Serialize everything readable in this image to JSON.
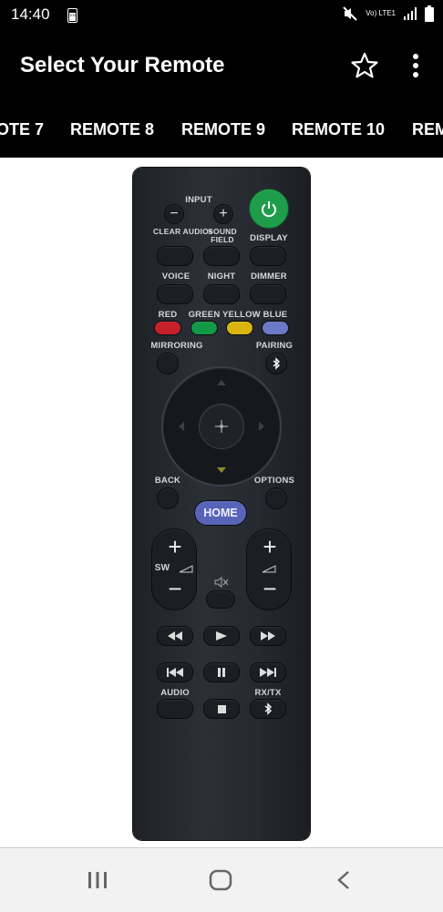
{
  "status_bar": {
    "time": "14:40",
    "battery_level": "100",
    "network": "Vo) LTE1"
  },
  "app_bar": {
    "title": "Select Your Remote"
  },
  "tabs": [
    "OTE 7",
    "REMOTE 8",
    "REMOTE 9",
    "REMOTE 10",
    "REM"
  ],
  "remote": {
    "labels": {
      "input": "INPUT",
      "clear_audio": "CLEAR AUDIO+",
      "sound_field": "SOUND FIELD",
      "display": "DISPLAY",
      "voice": "VOICE",
      "night": "NIGHT",
      "dimmer": "DIMMER",
      "red": "RED",
      "green": "GREEN",
      "yellow": "YELLOW",
      "blue": "BLUE",
      "mirroring": "MIRRORING",
      "pairing": "PAIRING",
      "back": "BACK",
      "options": "OPTIONS",
      "home": "HOME",
      "sw": "SW",
      "audio": "AUDIO",
      "rx_tx": "RX/TX"
    },
    "colors": {
      "power": "#1f9d4a",
      "red": "#c8202b",
      "green": "#129a47",
      "yellow": "#d9b512",
      "blue": "#6b79c9",
      "home": "#5864b8"
    }
  }
}
